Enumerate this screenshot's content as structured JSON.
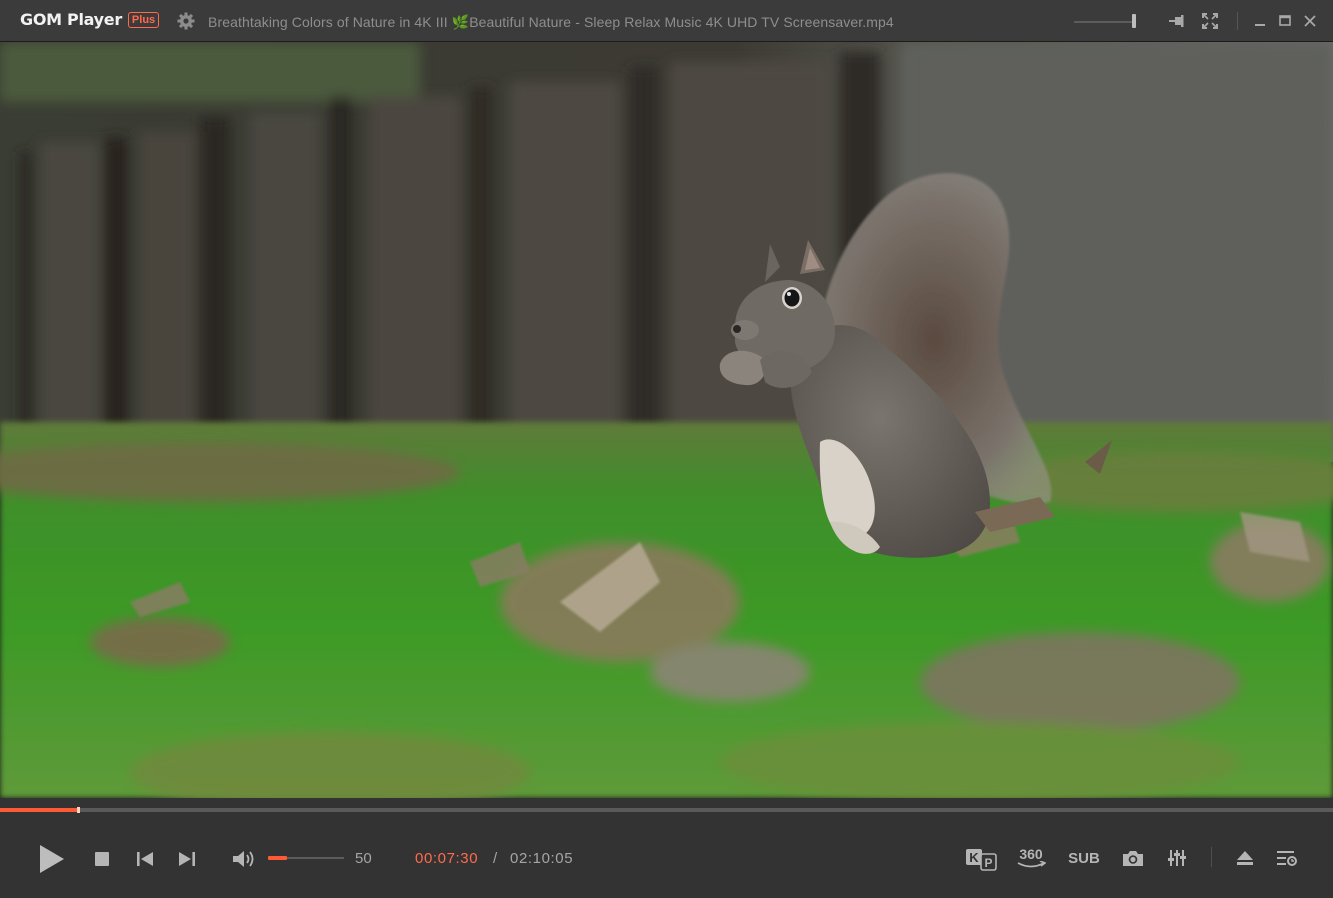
{
  "app": {
    "name": "GOM Player",
    "badge": "Plus",
    "title": "Breathtaking Colors of Nature in 4K III 🌿Beautiful Nature - Sleep Relax Music 4K UHD TV Screensaver.mp4"
  },
  "titlebar": {
    "icons": [
      "gear-icon",
      "pin-icon",
      "fullscreen-icon",
      "minimize-icon",
      "maximize-icon",
      "close-icon"
    ],
    "opacity_level": 0.95
  },
  "player": {
    "progress_fraction": 0.0577,
    "current_time": "00:07:30",
    "time_separator": "/",
    "total_time": "02:10:05",
    "volume": "50",
    "volume_fraction": 0.5
  },
  "controls": {
    "left": [
      "play-icon",
      "stop-icon",
      "previous-icon",
      "next-icon",
      "volume-icon"
    ],
    "right": {
      "kp_icon": "kp-icon",
      "label_360": "360",
      "label_sub": "SUB",
      "icons": [
        "camera-icon",
        "equalizer-icon",
        "eject-icon",
        "playlist-icon"
      ]
    }
  },
  "colors": {
    "accent": "#ff5a36",
    "titlebar_bg": "#3b3b3b",
    "control_bg": "#333333"
  }
}
